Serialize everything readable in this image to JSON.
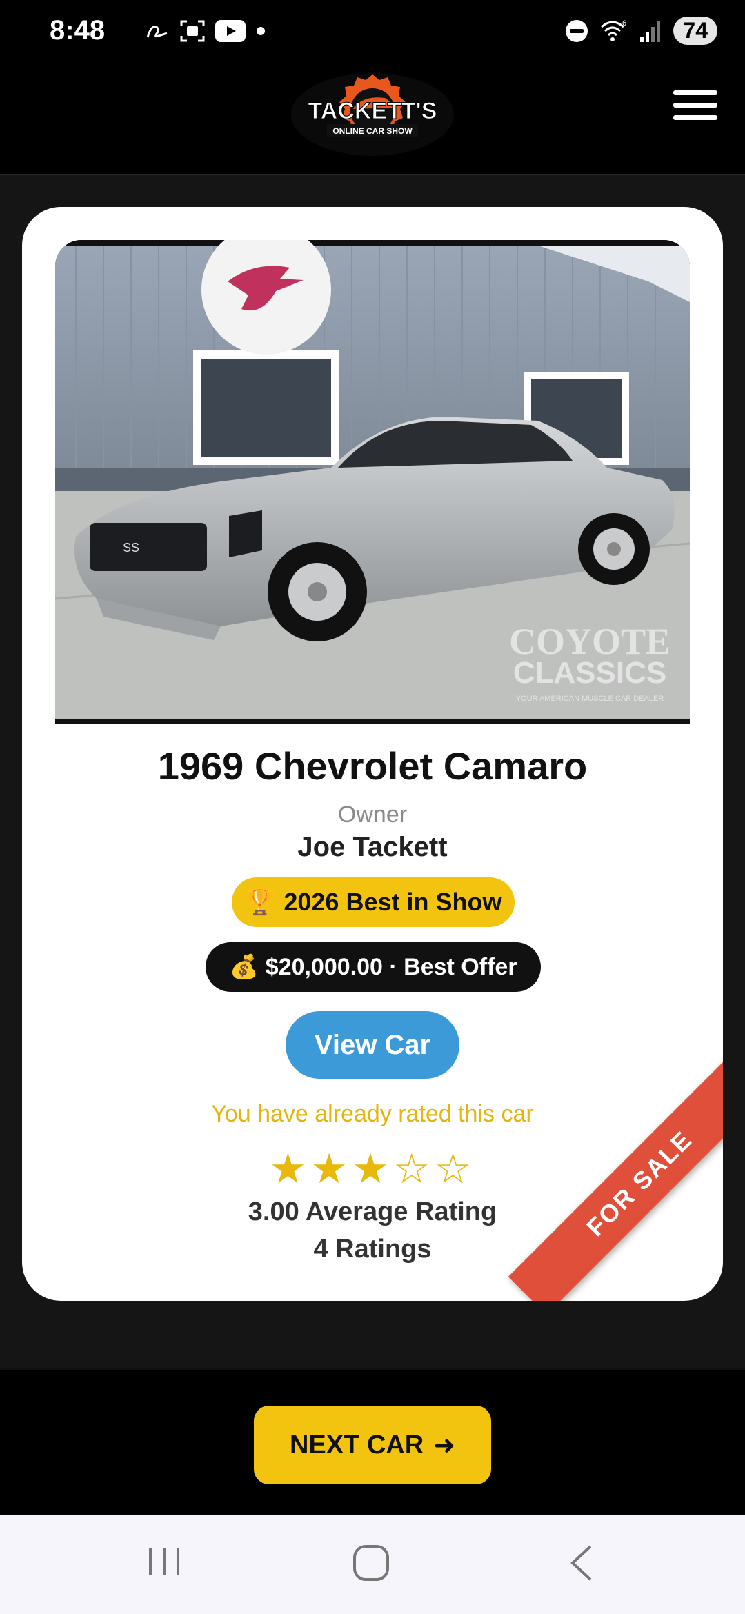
{
  "status_bar": {
    "time": "8:48",
    "battery": "74",
    "icons": [
      "a-icon",
      "screenshot-icon",
      "youtube-icon",
      "dot-icon",
      "dnd-icon",
      "wifi-6-icon",
      "signal-icon"
    ]
  },
  "header": {
    "logo": {
      "name": "TACKETT'S",
      "tagline": "ONLINE CAR SHOW"
    },
    "menu_icon": "hamburger-icon"
  },
  "car": {
    "title": "1969 Chevrolet Camaro",
    "owner_label": "Owner",
    "owner_name": "Joe Tackett",
    "award_icon": "🏆",
    "award": "2026 Best in Show",
    "price_icon": "💰",
    "price": "$20,000.00 · Best Offer",
    "view_button": "View Car",
    "rating_message": "You have already rated this car",
    "stars_display": "★★★☆☆",
    "rating_value": 3,
    "rating_max": 5,
    "average": "3.00 Average Rating",
    "count": "4 Ratings",
    "ribbon": "FOR SALE",
    "photo_watermark": {
      "line1": "COYOTE",
      "line2": "CLASSICS",
      "line3": "YOUR AMERICAN MUSCLE CAR DEALER"
    }
  },
  "next_button": {
    "label": "NEXT CAR",
    "arrow": "➜"
  },
  "colors": {
    "accent_yellow": "#f2c30f",
    "button_blue": "#3d9ad9",
    "ribbon_red": "#e04f3a",
    "star_gold": "#e8b90b",
    "background": "#111111"
  }
}
